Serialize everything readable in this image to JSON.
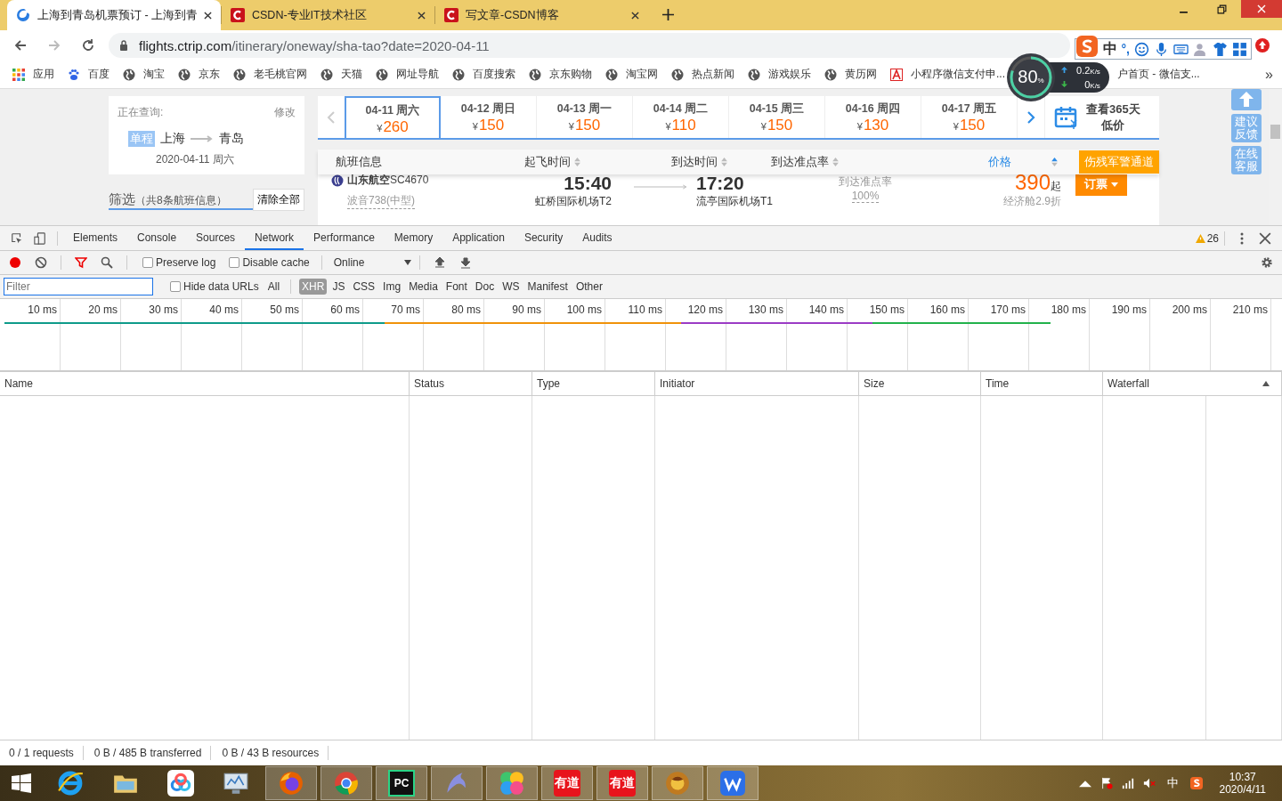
{
  "browser_tabs": [
    {
      "title": "上海到青岛机票预订 - 上海到青",
      "selected": true,
      "kind": "swirl"
    },
    {
      "title": "CSDN-专业IT技术社区",
      "selected": false,
      "kind": "arc"
    },
    {
      "title": "写文章-CSDN博客",
      "selected": false,
      "kind": "arc"
    }
  ],
  "address": {
    "host": "flights.ctrip.com",
    "path": "/itinerary/oneway/sha-tao?date=2020-04-11"
  },
  "ime_toolbar": {
    "mode": "中",
    "punct": "°,"
  },
  "bookmarks": [
    {
      "label": "应用",
      "kind": "apps"
    },
    {
      "label": "百度",
      "kind": "paw"
    },
    {
      "label": "淘宝",
      "kind": "globe"
    },
    {
      "label": "京东",
      "kind": "globe"
    },
    {
      "label": "老毛桃官网",
      "kind": "globe"
    },
    {
      "label": "天猫",
      "kind": "globe"
    },
    {
      "label": "网址导航",
      "kind": "globe"
    },
    {
      "label": "百度搜索",
      "kind": "globe"
    },
    {
      "label": "京东购物",
      "kind": "globe"
    },
    {
      "label": "淘宝网",
      "kind": "globe"
    },
    {
      "label": "热点新闻",
      "kind": "globe"
    },
    {
      "label": "游戏娱乐",
      "kind": "globe"
    },
    {
      "label": "黄历网",
      "kind": "globe"
    },
    {
      "label": "小程序微信支付申...",
      "kind": "doc"
    },
    {
      "label": "户首页 - 微信支...",
      "kind": "none"
    }
  ],
  "bookmarks_more": "»",
  "speed_widget": {
    "percent": "80",
    "unit": "%",
    "up": "0.2",
    "down": "0",
    "rate_unit_up": "K/s",
    "rate_unit_down": "K/s"
  },
  "search_summary": {
    "label": "正在查询:",
    "edit": "修改",
    "trip_type": "单程",
    "from": "上海",
    "to": "青岛",
    "date": "2020-04-11 周六"
  },
  "filter_panel": {
    "title": "筛选",
    "count": "（共8条航班信息）",
    "clear": "清除全部"
  },
  "date_strip": [
    {
      "date": "04-11 周六",
      "currency": "¥",
      "price": "260",
      "selected": true
    },
    {
      "date": "04-12 周日",
      "currency": "¥",
      "price": "150",
      "selected": false
    },
    {
      "date": "04-13 周一",
      "currency": "¥",
      "price": "150",
      "selected": false
    },
    {
      "date": "04-14 周二",
      "currency": "¥",
      "price": "110",
      "selected": false
    },
    {
      "date": "04-15 周三",
      "currency": "¥",
      "price": "150",
      "selected": false
    },
    {
      "date": "04-16 周四",
      "currency": "¥",
      "price": "130",
      "selected": false
    },
    {
      "date": "04-17 周五",
      "currency": "¥",
      "price": "150",
      "selected": false
    }
  ],
  "calendar_link": [
    "查看365天",
    "低价"
  ],
  "result_columns": [
    {
      "label": "航班信息",
      "sortable": false,
      "selected": false
    },
    {
      "label": "起飞时间",
      "sortable": true,
      "selected": false
    },
    {
      "label": "到达时间",
      "sortable": true,
      "selected": false
    },
    {
      "label": "到达准点率",
      "sortable": true,
      "selected": false
    },
    {
      "label": "价格",
      "sortable": true,
      "selected": true
    }
  ],
  "special_button": "伤残军警通道",
  "flight": {
    "airline": "山东航空",
    "number": "SC4670",
    "aircraft": "波音738(中型)",
    "depart_time": "15:40",
    "depart_airport": "虹桥国际机场T2",
    "arrive_time": "17:20",
    "arrive_airport": "流亭国际机场T1",
    "ontime_label": "到达准点率",
    "ontime": "100%",
    "price": "390",
    "price_suffix": "起",
    "cabin": "经济舱2.9折",
    "book": "订票"
  },
  "side_buttons": [
    {
      "kind": "top"
    },
    {
      "kind": "text",
      "label": "建议反馈"
    },
    {
      "kind": "text",
      "label": "在线客服"
    }
  ],
  "devtools": {
    "tabs": [
      {
        "label": "Elements",
        "selected": false
      },
      {
        "label": "Console",
        "selected": false
      },
      {
        "label": "Sources",
        "selected": false
      },
      {
        "label": "Network",
        "selected": true
      },
      {
        "label": "Performance",
        "selected": false
      },
      {
        "label": "Memory",
        "selected": false
      },
      {
        "label": "Application",
        "selected": false
      },
      {
        "label": "Security",
        "selected": false
      },
      {
        "label": "Audits",
        "selected": false
      }
    ],
    "warnings": "26",
    "recording": true,
    "preserve_log": {
      "label": "Preserve log",
      "checked": false
    },
    "disable_cache": {
      "label": "Disable cache",
      "checked": false
    },
    "throttle": "Online",
    "filter": {
      "placeholder": "Filter"
    },
    "hide_data_urls": {
      "label": "Hide data URLs",
      "checked": false
    },
    "types": [
      {
        "label": "All",
        "selected": false
      },
      {
        "label": "XHR",
        "selected": true
      },
      {
        "label": "JS",
        "selected": false
      },
      {
        "label": "CSS",
        "selected": false
      },
      {
        "label": "Img",
        "selected": false
      },
      {
        "label": "Media",
        "selected": false
      },
      {
        "label": "Font",
        "selected": false
      },
      {
        "label": "Doc",
        "selected": false
      },
      {
        "label": "WS",
        "selected": false
      },
      {
        "label": "Manifest",
        "selected": false
      },
      {
        "label": "Other",
        "selected": false
      }
    ],
    "ticks": [
      "10 ms",
      "20 ms",
      "30 ms",
      "40 ms",
      "50 ms",
      "60 ms",
      "70 ms",
      "80 ms",
      "90 ms",
      "100 ms",
      "110 ms",
      "120 ms",
      "130 ms",
      "140 ms",
      "150 ms",
      "160 ms",
      "170 ms",
      "180 ms",
      "190 ms",
      "200 ms",
      "210 ms"
    ],
    "columns": [
      {
        "label": "Name",
        "sorted": false
      },
      {
        "label": "Status",
        "sorted": false
      },
      {
        "label": "Type",
        "sorted": false
      },
      {
        "label": "Initiator",
        "sorted": false
      },
      {
        "label": "Size",
        "sorted": false
      },
      {
        "label": "Time",
        "sorted": false
      },
      {
        "label": "Waterfall",
        "sorted": true
      }
    ],
    "status": [
      "0 / 1 requests",
      "0 B / 485 B transferred",
      "0 B / 43 B resources"
    ]
  },
  "taskbar": {
    "apps": [
      {
        "kind": "ie",
        "active": false
      },
      {
        "kind": "folder",
        "active": false
      },
      {
        "kind": "cloud",
        "active": false
      },
      {
        "kind": "monitor",
        "active": false
      },
      {
        "kind": "firefox",
        "active": true
      },
      {
        "kind": "chrome",
        "active": true
      },
      {
        "kind": "ide",
        "label": "PC",
        "active": true
      },
      {
        "kind": "dolphin",
        "active": true
      },
      {
        "kind": "clover",
        "active": true
      },
      {
        "kind": "youdao",
        "label": "有道",
        "active": true
      },
      {
        "kind": "youdao",
        "label": "有道",
        "active": true
      },
      {
        "kind": "game",
        "active": true
      },
      {
        "kind": "wps",
        "active": true
      }
    ],
    "ime": "中",
    "time": "10:37",
    "date": "2020/4/11"
  }
}
